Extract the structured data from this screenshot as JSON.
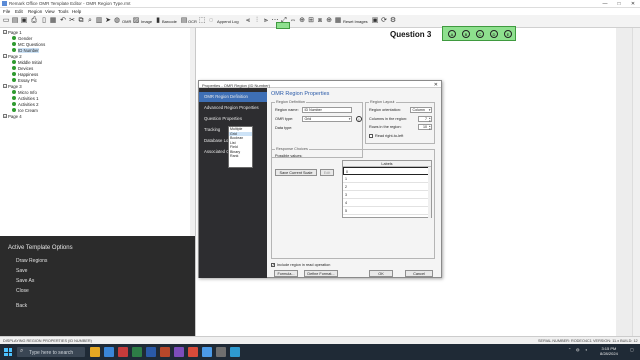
{
  "window": {
    "title": "Remark Office OMR Template Editor - OMR Region Type.rmt",
    "minimize": "—",
    "maximize": "□",
    "close": "✕"
  },
  "menu": [
    "File",
    "Edit",
    "Region",
    "View",
    "Tools",
    "Help"
  ],
  "toolbar": {
    "omr": "OMR",
    "image": "Image",
    "barcode": "Barcode",
    "ocr": "OCR",
    "append_log": "Append Log",
    "reset_images": "Reset Images"
  },
  "tree": [
    {
      "label": "Page 1",
      "level": 0,
      "expander": "−",
      "dot": false
    },
    {
      "label": "Gender",
      "level": 1,
      "dot": true
    },
    {
      "label": "MC Questions",
      "level": 1,
      "dot": true
    },
    {
      "label": "ID Number",
      "level": 1,
      "dot": true,
      "selected": true
    },
    {
      "label": "Page 2",
      "level": 0,
      "expander": "−",
      "dot": false
    },
    {
      "label": "Middle Initial",
      "level": 1,
      "dot": true
    },
    {
      "label": "Devices",
      "level": 1,
      "dot": true
    },
    {
      "label": "Happiness",
      "level": 1,
      "dot": true
    },
    {
      "label": "Essay Pic",
      "level": 1,
      "dot": true
    },
    {
      "label": "Page 3",
      "level": 0,
      "expander": "−",
      "dot": false
    },
    {
      "label": "Micro Info",
      "level": 1,
      "dot": true
    },
    {
      "label": "Activities 1",
      "level": 1,
      "dot": true
    },
    {
      "label": "Activities 2",
      "level": 1,
      "dot": true
    },
    {
      "label": "Ice Cream",
      "level": 1,
      "dot": true
    },
    {
      "label": "Page 4",
      "level": 0,
      "expander": "+",
      "dot": false
    }
  ],
  "canvas": {
    "question_label": "Question 3",
    "bubbles": [
      "A",
      "B",
      "C",
      "D",
      "E"
    ]
  },
  "options": {
    "heading": "Active Template Options",
    "items": [
      "Draw Regions",
      "Save",
      "Save As",
      "Close",
      "Back"
    ]
  },
  "status": {
    "left": "DISPLAYING REGION PROPERTIES (ID NUMBER)",
    "serial": "SERIAL NUMBER: RODEO4C1",
    "version": "VERSION: 11.x  BUILD: 12"
  },
  "taskbar": {
    "search_placeholder": "Type here to search",
    "time": "3:15 PM",
    "date": "8/28/2024"
  },
  "dialog": {
    "title": "Properties - OMR Region (ID Number)",
    "close": "✕",
    "nav": [
      "OMR Region Definition",
      "Advanced Region Properties",
      "Question Properties",
      "Tracking",
      "Database Lookup",
      "Associated Question"
    ],
    "heading": "OMR Region Properties",
    "region_definition": {
      "group_label": "Region Definition",
      "name_label": "Region name:",
      "name_value": "ID Number",
      "type_label": "OMR type:",
      "type_value": "Grid",
      "data_type_label": "Data type:",
      "type_options": [
        "Multiple",
        "Grid",
        "Boolean",
        "List",
        "Field",
        "Binary",
        "Rank"
      ],
      "type_highlight_index": 1
    },
    "region_layout": {
      "group_label": "Region Layout",
      "orientation_label": "Region orientation:",
      "orientation_value": "Column",
      "columns_label": "Columns in the region:",
      "columns_value": "7",
      "rows_label": "Rows in the region:",
      "rows_value": "10",
      "rtl_label": "Read right-to-left"
    },
    "response_choices": {
      "group_label": "Response Choices",
      "possible_label": "Possible values:",
      "save_scale_button": "Save Current Scale",
      "edit_button": "Edit",
      "labels_header": "Labels",
      "labels": [
        "0",
        "1",
        "2",
        "3",
        "4",
        "5"
      ]
    },
    "include_label": "Include region in read operation",
    "include_checked": "✓",
    "buttons": {
      "formula": "Formula...",
      "define_format": "Define Format...",
      "ok": "OK",
      "cancel": "Cancel"
    }
  }
}
